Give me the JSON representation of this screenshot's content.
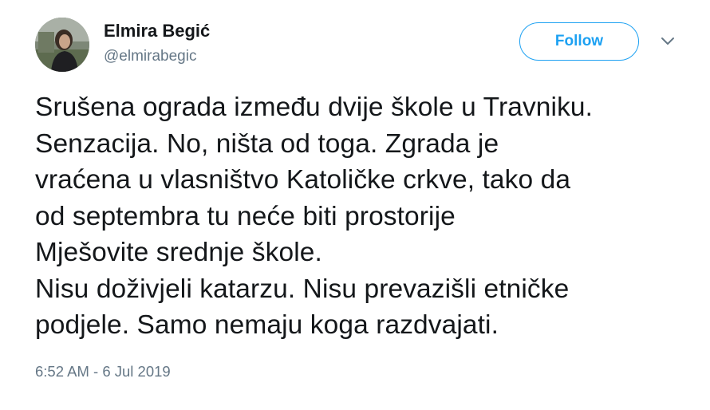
{
  "author": {
    "name": "Elmira Begić",
    "handle": "@elmirabegic"
  },
  "actions": {
    "follow_label": "Follow",
    "menu_icon": "chevron-down-icon"
  },
  "tweet": {
    "lines": [
      "Srušena ograda između dvije škole u Travniku.",
      "Senzacija. No, ništa od toga. Zgrada je",
      "vraćena u vlasništvo Katoličke crkve, tako da",
      "od septembra tu neće biti prostorije",
      "Mješovite srednje škole.",
      "Nisu doživjeli katarzu. Nisu prevazišli etničke",
      "podjele. Samo nemaju koga razdvajati."
    ],
    "timestamp": "6:52 AM - 6 Jul 2019"
  },
  "colors": {
    "accent": "#1da1f2",
    "text": "#14171a",
    "secondary": "#657786"
  }
}
